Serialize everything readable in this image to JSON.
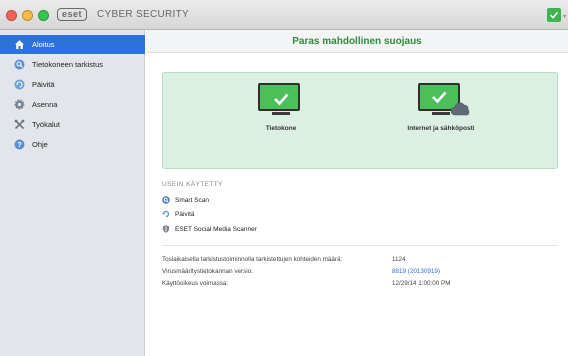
{
  "app": {
    "logo_text": "eset",
    "product_name": "CYBER SECURITY"
  },
  "sidebar": {
    "items": [
      {
        "label": "Aloitus",
        "icon": "home-icon",
        "active": true
      },
      {
        "label": "Tietokoneen tarkistus",
        "icon": "magnifier-icon",
        "active": false
      },
      {
        "label": "Päivitä",
        "icon": "update-icon",
        "active": false
      },
      {
        "label": "Asenna",
        "icon": "gear-icon",
        "active": false
      },
      {
        "label": "Työkalut",
        "icon": "tools-icon",
        "active": false
      },
      {
        "label": "Ohje",
        "icon": "help-icon",
        "active": false
      }
    ]
  },
  "main": {
    "status_title": "Paras mahdollinen suojaus",
    "protection": [
      {
        "label": "Tietokone",
        "icon": "monitor-check-icon"
      },
      {
        "label": "Internet ja sähköposti",
        "icon": "monitor-cloud-icon"
      }
    ],
    "frequently_used": {
      "title": "USEIN KÄYTETTY",
      "items": [
        {
          "label": "Smart Scan",
          "icon": "scan-icon"
        },
        {
          "label": "Päivitä",
          "icon": "refresh-icon"
        },
        {
          "label": "ESET Social Media Scanner",
          "icon": "shield-icon"
        }
      ]
    },
    "info": [
      {
        "label": "Tosiaikaisella tarkistustoiminnolla tarkistettujen kohteiden määrä:",
        "value": "1124",
        "link": false
      },
      {
        "label": "Virusmääritystietokannan versio:",
        "value": "8819 (20130919)",
        "link": true
      },
      {
        "label": "Käyttöoikeus voimassa:",
        "value": "12/29/14 1:00:00 PM",
        "link": false
      }
    ]
  },
  "colors": {
    "accent_blue": "#2d72d9",
    "status_green": "#2e8b3a",
    "protection_bg": "#dcefe3",
    "link": "#2f6fd0"
  }
}
